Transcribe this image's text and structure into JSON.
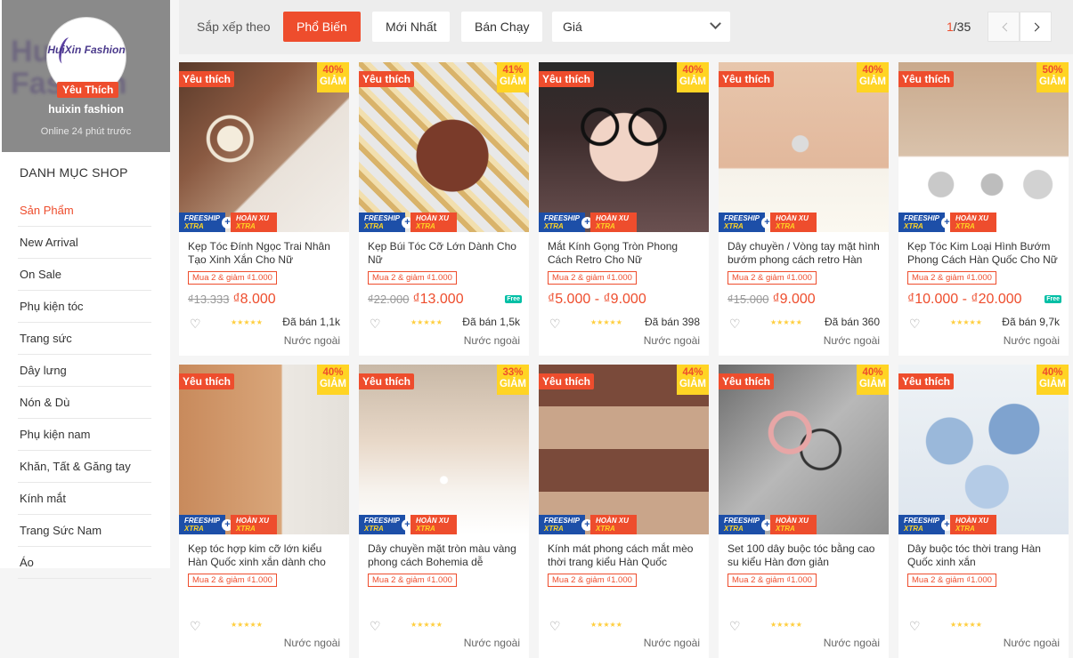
{
  "shop": {
    "logo_text": "HuiXin Fashion",
    "bg_text": "HuiXin Fashion",
    "badge": "Yêu Thích",
    "name": "huixin fashion",
    "online": "Online 24 phút trước"
  },
  "categories": {
    "title": "DANH MỤC SHOP",
    "items": [
      {
        "label": "Sản Phẩm"
      },
      {
        "label": "New Arrival"
      },
      {
        "label": "On Sale"
      },
      {
        "label": "Phụ kiện tóc"
      },
      {
        "label": "Trang sức"
      },
      {
        "label": "Dây lưng"
      },
      {
        "label": "Nón & Dù"
      },
      {
        "label": "Phụ kiện nam"
      },
      {
        "label": "Khăn, Tất & Găng tay"
      },
      {
        "label": "Kính mắt"
      },
      {
        "label": "Trang Sức Nam"
      },
      {
        "label": "Áo"
      }
    ]
  },
  "sort": {
    "label": "Sắp xếp theo",
    "popular": "Phổ Biến",
    "newest": "Mới Nhất",
    "bestseller": "Bán Chạy",
    "price": "Giá"
  },
  "pager": {
    "current": "1",
    "total": "/35"
  },
  "common": {
    "fav": "Yêu thích",
    "discount_label": "GIẢM",
    "freeship": "FREESHIP",
    "xtra": "XTRA",
    "hoanxu": "HOÀN XU",
    "plus": "+",
    "promo": "Mua 2 & giảm ₫1.000",
    "origin": "Nước ngoài",
    "stars": "★★★★★",
    "heart": "♡",
    "free_label": "Free"
  },
  "products": [
    {
      "name": "Kẹp Tóc Đính Ngọc Trai Nhân Tạo Xinh Xắn Cho Nữ",
      "discount": "40%",
      "old_price": "₫13.333",
      "price": "₫8.000",
      "sold": "Đã bán 1,1k",
      "free": false,
      "image": "pearl-clip"
    },
    {
      "name": "Kẹp Búi Tóc Cỡ Lớn Dành Cho Nữ",
      "discount": "41%",
      "old_price": "₫22.000",
      "price": "₫13.000",
      "sold": "Đã bán 1,5k",
      "free": true,
      "image": "gold-claws"
    },
    {
      "name": "Mắt Kính Gọng Tròn Phong Cách Retro Cho Nữ",
      "discount": "40%",
      "old_price": "",
      "price": "₫5.000 - ₫9.000",
      "sold": "Đã bán 398",
      "free": false,
      "image": "round-glasses"
    },
    {
      "name": "Dây chuyền / Vòng tay mặt hình bướm phong cách retro Hàn Quốc",
      "discount": "40%",
      "old_price": "₫15.000",
      "price": "₫9.000",
      "sold": "Đã bán 360",
      "free": false,
      "image": "butterfly-necklace"
    },
    {
      "name": "Kẹp Tóc Kim Loại Hình Bướm Phong Cách Hàn Quốc Cho Nữ",
      "discount": "50%",
      "old_price": "",
      "price": "₫10.000 - ₫20.000",
      "sold": "Đã bán 9,7k",
      "free": true,
      "image": "metal-clips"
    },
    {
      "name": "Kẹp tóc hợp kim cỡ lớn kiểu Hàn Quốc xinh xắn dành cho nữ",
      "discount": "40%",
      "image": "alloy-clip"
    },
    {
      "name": "Dây chuyền mặt tròn màu vàng phong cách Bohemia dễ thương",
      "discount": "33%",
      "image": "pearl-necklace"
    },
    {
      "name": "Kính mát phong cách mắt mèo thời trang kiểu Hàn Quốc",
      "discount": "44%",
      "image": "cat-eye"
    },
    {
      "name": "Set 100 dây buộc tóc bằng cao su kiểu Hàn đơn giản",
      "discount": "40%",
      "image": "hair-ties"
    },
    {
      "name": "Dây buộc tóc thời trang Hàn Quốc xinh xắn",
      "discount": "40%",
      "image": "scrunchies"
    }
  ]
}
